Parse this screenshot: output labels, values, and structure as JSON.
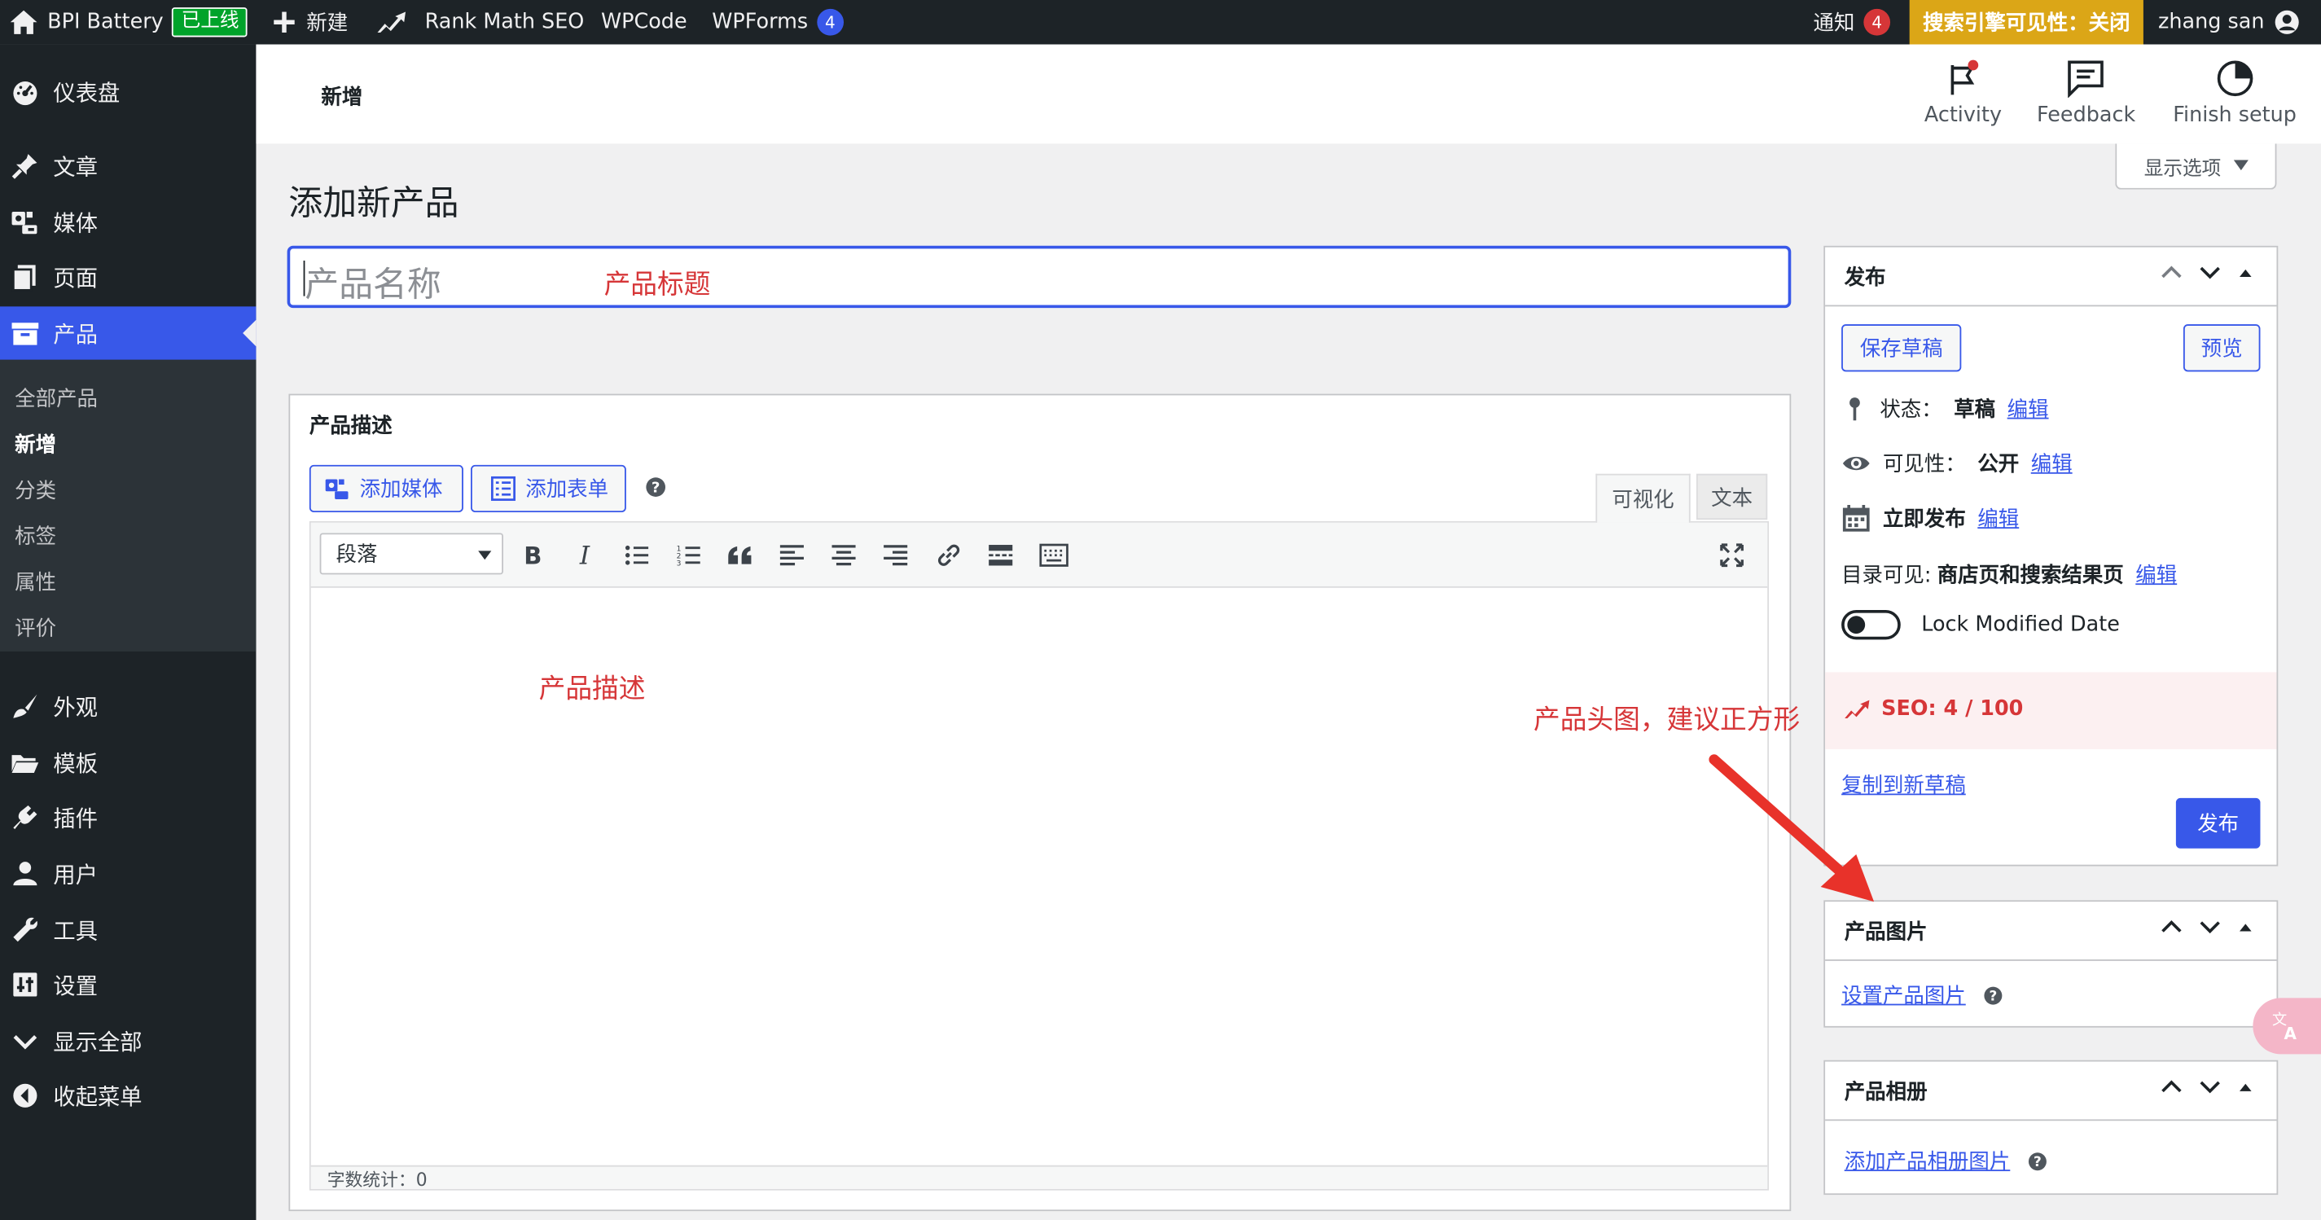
{
  "admin_bar": {
    "site_name": "BPI Battery",
    "live_badge": "已上线",
    "new_label": "新建",
    "rankmath_label": "Rank Math SEO",
    "wpcode_label": "WPCode",
    "wpforms_label": "WPForms",
    "wpforms_count": "4",
    "notifications_label": "通知",
    "notifications_count": "4",
    "seo_visibility": "搜索引擎可见性：关闭",
    "user_name": "zhang san"
  },
  "sidebar": {
    "items": [
      {
        "label": "仪表盘",
        "icon": "dashboard-icon"
      },
      {
        "label": "文章",
        "icon": "pin-icon"
      },
      {
        "label": "媒体",
        "icon": "media-icon"
      },
      {
        "label": "页面",
        "icon": "pages-icon"
      },
      {
        "label": "产品",
        "icon": "archive-icon"
      },
      {
        "label": "外观",
        "icon": "brush-icon"
      },
      {
        "label": "模板",
        "icon": "folder-icon"
      },
      {
        "label": "插件",
        "icon": "plugin-icon"
      },
      {
        "label": "用户",
        "icon": "user-icon"
      },
      {
        "label": "工具",
        "icon": "wrench-icon"
      },
      {
        "label": "设置",
        "icon": "settings-icon"
      },
      {
        "label": "显示全部",
        "icon": "chevron-down-icon"
      },
      {
        "label": "收起菜单",
        "icon": "collapse-icon"
      }
    ],
    "submenu": [
      "全部产品",
      "新增",
      "分类",
      "标签",
      "属性",
      "评价"
    ]
  },
  "wc_header": {
    "page_tag": "新增",
    "activity": "Activity",
    "feedback": "Feedback",
    "finish_setup": "Finish setup"
  },
  "page": {
    "title": "添加新产品",
    "screen_options": "显示选项",
    "title_placeholder": "产品名称"
  },
  "annotations": {
    "title": "产品标题",
    "description": "产品描述",
    "image": "产品头图，建议正方形"
  },
  "description_box": {
    "heading": "产品描述",
    "add_media": "添加媒体",
    "add_form": "添加表单",
    "tab_visual": "可视化",
    "tab_text": "文本",
    "format_select": "段落",
    "word_count": "字数统计：0"
  },
  "publish_box": {
    "heading": "发布",
    "save_draft": "保存草稿",
    "preview": "预览",
    "status_label": "状态：",
    "status_value": "草稿",
    "visibility_label": "可见性：",
    "visibility_value": "公开",
    "publish_time": "立即发布",
    "edit": "编辑",
    "catalog_label": "目录可见:",
    "catalog_value": "商店页和搜索结果页",
    "lock_modified": "Lock Modified Date",
    "seo_score": "SEO: 4 / 100",
    "copy_draft": "复制到新草稿",
    "publish": "发布"
  },
  "product_image_box": {
    "heading": "产品图片",
    "set_image": "设置产品图片"
  },
  "gallery_box": {
    "heading": "产品相册",
    "add_gallery": "添加产品相册图片"
  },
  "colors": {
    "accent": "#3858e9",
    "admin_bar": "#1d2327",
    "seo_visibility_bg": "#dba617",
    "annotation": "#d63638",
    "seo_score": "#d63638"
  }
}
